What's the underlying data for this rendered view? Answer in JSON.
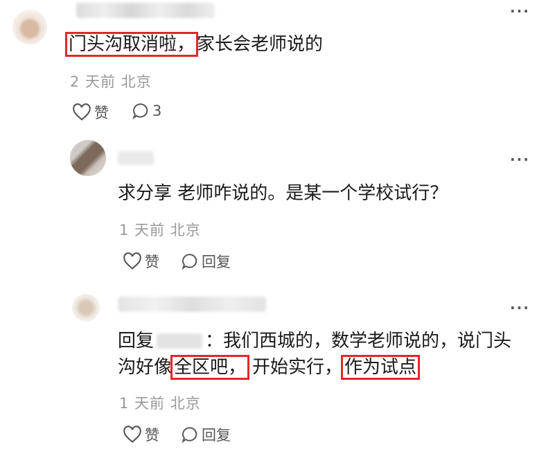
{
  "comment1": {
    "text_highlight": "门头沟取消啦，",
    "text_rest": "家长会老师说的",
    "meta": "2 天前 北京",
    "like_label": "赞",
    "reply_count": "3",
    "more": "···"
  },
  "comment2": {
    "text": "求分享 老师咋说的。是某一个学校试行？",
    "meta": "1 天前 北京",
    "like_label": "赞",
    "reply_label": "回复",
    "more": "···"
  },
  "comment3": {
    "reply_prefix": "回复",
    "line1_after": "：我们西城的，数学老师说的，说门头",
    "line2_a": "沟好像",
    "line2_hl1": "全区吧，",
    "line2_b": "开始实行，",
    "line2_hl2": "作为试点",
    "meta": "1 天前 北京",
    "like_label": "赞",
    "reply_label": "回复",
    "more": "···"
  },
  "colors": {
    "highlight_border": "#e3262b",
    "meta_text": "#999999"
  }
}
